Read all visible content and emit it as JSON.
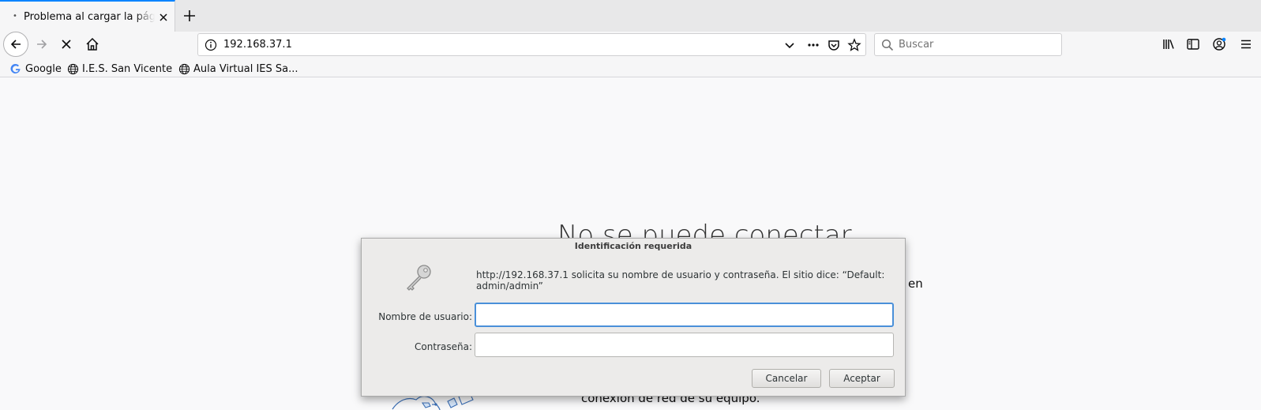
{
  "tabs": [
    {
      "title": "Problema al cargar la página",
      "favicon": "dot-icon",
      "active": true
    }
  ],
  "navbar": {
    "url": "192.168.37.1",
    "search_placeholder": "Buscar"
  },
  "bookmarks": [
    {
      "label": "Google",
      "icon": "google-icon"
    },
    {
      "label": "I.E.S. San Vicente",
      "icon": "globe-icon"
    },
    {
      "label": "Aula Virtual IES Sa...",
      "icon": "globe-icon"
    }
  ],
  "error_page": {
    "title": "No se puede conectar",
    "line_right": "en",
    "line_bottom": "conexión de red de su equipo."
  },
  "dialog": {
    "title": "Identificación requerida",
    "message": "http://192.168.37.1 solicita su nombre de usuario y contraseña. El sitio dice: “Default: admin/admin”",
    "username_label": "Nombre de usuario:",
    "username_value": "",
    "password_label": "Contraseña:",
    "password_value": "",
    "cancel_label": "Cancelar",
    "accept_label": "Aceptar"
  },
  "colors": {
    "accent": "#0a84ff",
    "focus_ring": "#4a90d9",
    "dialog_bg": "#ecebea"
  }
}
